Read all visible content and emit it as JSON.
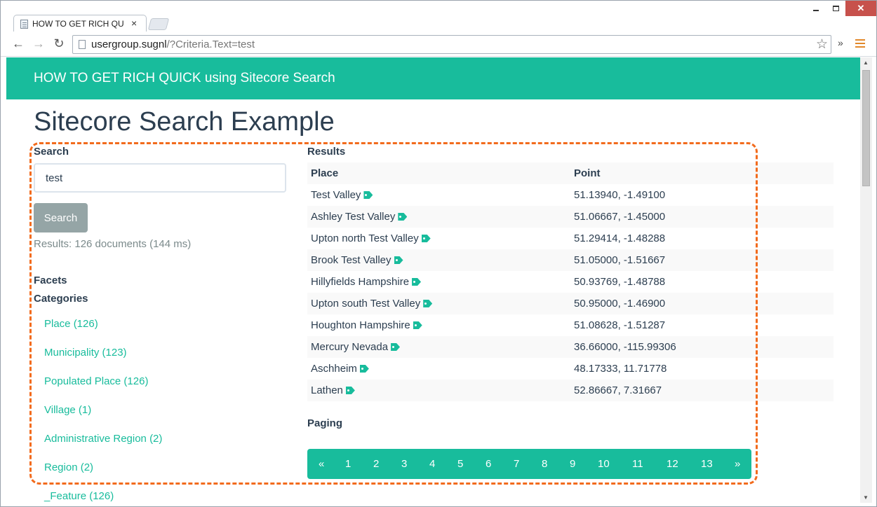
{
  "browser": {
    "tab_title": "HOW TO GET RICH QUICK",
    "tab_close": "×",
    "url_host": "usergroup.sugnl",
    "url_path": "/?Criteria.Text=test",
    "back_icon": "arrow-left-icon",
    "forward_icon": "arrow-right-icon",
    "reload_icon": "reload-icon",
    "bookmark_icon": "star-icon",
    "overflow_label": "»",
    "menu_icon": "hamburger-menu-icon"
  },
  "site": {
    "brand": "HOW TO GET RICH QUICK using Sitecore Search",
    "brand_color": "#18bc9c"
  },
  "page": {
    "title": "Sitecore Search Example"
  },
  "search": {
    "label": "Search",
    "value": "test",
    "button_label": "Search",
    "results_info": "Results: 126 documents (144 ms)"
  },
  "facets": {
    "heading": "Facets",
    "categories_heading": "Categories",
    "items": [
      "Place (126)",
      "Municipality (123)",
      "Populated Place (126)",
      "Village (1)",
      "Administrative Region (2)",
      "Region (2)",
      "_Feature (126)"
    ]
  },
  "results": {
    "heading": "Results",
    "columns": [
      "Place",
      "Point"
    ],
    "rows": [
      {
        "place": "Test Valley",
        "point": "51.13940, -1.49100"
      },
      {
        "place": "Ashley Test Valley",
        "point": "51.06667, -1.45000"
      },
      {
        "place": "Upton north Test Valley",
        "point": "51.29414, -1.48288"
      },
      {
        "place": "Brook Test Valley",
        "point": "51.05000, -1.51667"
      },
      {
        "place": "Hillyfields Hampshire",
        "point": "50.93769, -1.48788"
      },
      {
        "place": "Upton south Test Valley",
        "point": "50.95000, -1.46900"
      },
      {
        "place": "Houghton Hampshire",
        "point": "51.08628, -1.51287"
      },
      {
        "place": "Mercury Nevada",
        "point": "36.66000, -115.99306"
      },
      {
        "place": "Aschheim",
        "point": "48.17333, 11.71778"
      },
      {
        "place": "Lathen",
        "point": "52.86667, 7.31667"
      }
    ],
    "row_icon": "tag-icon"
  },
  "paging": {
    "heading": "Paging",
    "prev": "«",
    "pages": [
      "1",
      "2",
      "3",
      "4",
      "5",
      "6",
      "7",
      "8",
      "9",
      "10",
      "11",
      "12",
      "13"
    ],
    "next": "»"
  },
  "annotation": {
    "color": "#f26b1d"
  }
}
